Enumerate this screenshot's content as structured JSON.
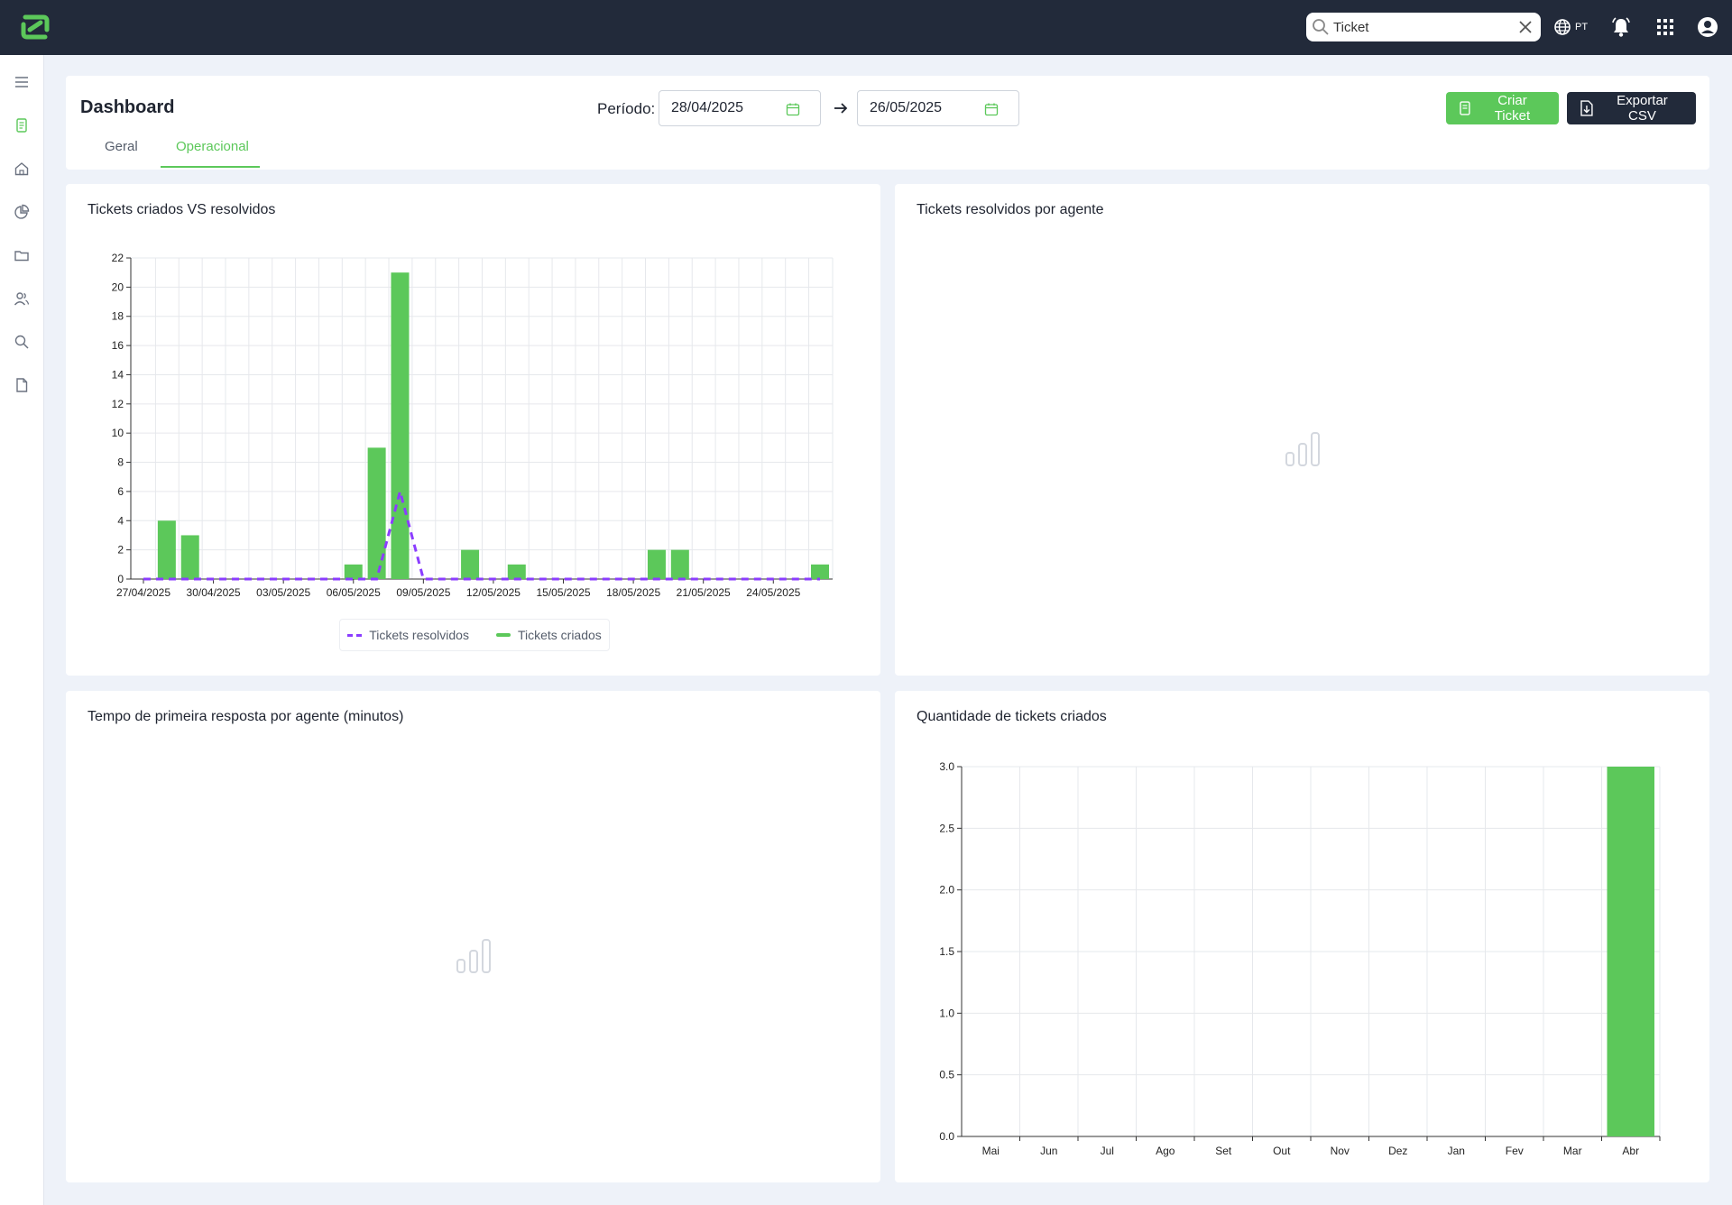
{
  "topbar": {
    "search": {
      "value": "Ticket",
      "placeholder": ""
    },
    "language": "PT"
  },
  "header": {
    "title": "Dashboard",
    "period_label": "Período:",
    "date_start": "28/04/2025",
    "date_end": "26/05/2025",
    "create_button": "Criar Ticket",
    "export_button": "Exportar CSV",
    "tabs": [
      {
        "label": "Geral",
        "active": false
      },
      {
        "label": "Operacional",
        "active": true
      }
    ]
  },
  "colors": {
    "brand_green": "#5cc85a",
    "dark": "#222a3a",
    "resolved_purple": "#8b3dff"
  },
  "panels": {
    "created_vs_resolved": {
      "title": "Tickets criados VS resolvidos"
    },
    "resolved_by_agent": {
      "title": "Tickets resolvidos por agente"
    },
    "first_response": {
      "title": "Tempo de primeira resposta por agente (minutos)"
    },
    "tickets_created": {
      "title": "Quantidade de tickets criados"
    }
  },
  "chart_data": [
    {
      "type": "bar",
      "title": "Tickets criados VS resolvidos",
      "x": [
        "27/04/2025",
        "28/04/2025",
        "29/04/2025",
        "30/04/2025",
        "01/05/2025",
        "02/05/2025",
        "03/05/2025",
        "04/05/2025",
        "05/05/2025",
        "06/05/2025",
        "07/05/2025",
        "08/05/2025",
        "09/05/2025",
        "10/05/2025",
        "11/05/2025",
        "12/05/2025",
        "13/05/2025",
        "14/05/2025",
        "15/05/2025",
        "16/05/2025",
        "17/05/2025",
        "18/05/2025",
        "19/05/2025",
        "20/05/2025",
        "21/05/2025",
        "22/05/2025",
        "23/05/2025",
        "24/05/2025",
        "25/05/2025",
        "26/05/2025"
      ],
      "x_tick_labels": [
        "27/04/2025",
        "30/04/2025",
        "03/05/2025",
        "06/05/2025",
        "09/05/2025",
        "12/05/2025",
        "15/05/2025",
        "18/05/2025",
        "21/05/2025",
        "24/05/2025"
      ],
      "y_ticks": [
        0,
        2,
        4,
        6,
        8,
        10,
        12,
        14,
        16,
        18,
        20,
        22
      ],
      "ylim": [
        0,
        22
      ],
      "grid": true,
      "legend_position": "bottom",
      "series": [
        {
          "name": "Tickets resolvidos",
          "type": "line",
          "style": "dashed",
          "color": "#8b3dff",
          "values": [
            0,
            0,
            0,
            0,
            0,
            0,
            0,
            0,
            0,
            0,
            0,
            6,
            0,
            0,
            0,
            0,
            0,
            0,
            0,
            0,
            0,
            0,
            0,
            0,
            0,
            0,
            0,
            0,
            0,
            0
          ]
        },
        {
          "name": "Tickets criados",
          "type": "bar",
          "color": "#5cc85a",
          "values": [
            0,
            4,
            3,
            0,
            0,
            0,
            0,
            0,
            0,
            1,
            9,
            21,
            0,
            0,
            2,
            0,
            1,
            0,
            0,
            0,
            0,
            0,
            2,
            2,
            0,
            0,
            0,
            0,
            0,
            1
          ]
        }
      ]
    },
    {
      "type": "bar",
      "title": "Quantidade de tickets criados",
      "categories": [
        "Mai",
        "Jun",
        "Jul",
        "Ago",
        "Set",
        "Out",
        "Nov",
        "Dez",
        "Jan",
        "Fev",
        "Mar",
        "Abr"
      ],
      "values": [
        0,
        0,
        0,
        0,
        0,
        0,
        0,
        0,
        0,
        0,
        0,
        3
      ],
      "y_ticks": [
        "0.0",
        "0.5",
        "1.0",
        "1.5",
        "2.0",
        "2.5",
        "3.0"
      ],
      "ylim": [
        0,
        3
      ],
      "grid": true,
      "color": "#5cc85a"
    }
  ]
}
